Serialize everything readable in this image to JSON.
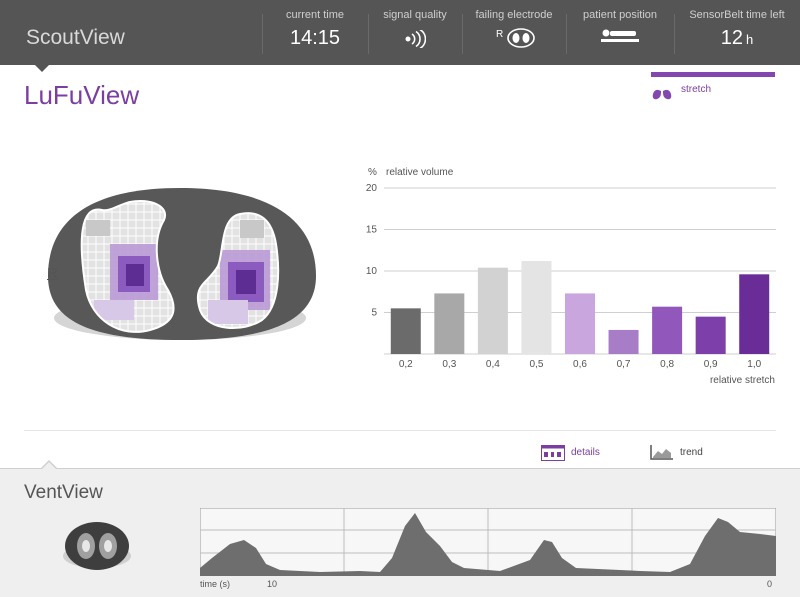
{
  "header": {
    "app_title": "ScoutView",
    "stats": [
      {
        "label": "current time",
        "value": "14:15",
        "unit": ""
      },
      {
        "label": "signal quality",
        "icon": "signal-icon"
      },
      {
        "label": "failing electrode",
        "value": "R",
        "icon": "electrode-icon"
      },
      {
        "label": "patient position",
        "icon": "patient-supine-icon"
      },
      {
        "label": "SensorBelt time left",
        "value": "12",
        "unit": "h"
      }
    ]
  },
  "lufu": {
    "title": "LuFuView",
    "side_marker": "R",
    "mode_tab": {
      "label": "stretch",
      "icon": "lungs-icon",
      "color": "#8447b0"
    }
  },
  "chart_data": {
    "type": "bar",
    "ylabel_unit": "%",
    "ylabel": "relative volume",
    "xlabel": "relative stretch",
    "ylim": [
      0,
      20
    ],
    "yticks": [
      5,
      10,
      15,
      20
    ],
    "categories": [
      "0,2",
      "0,3",
      "0,4",
      "0,5",
      "0,6",
      "0,7",
      "0,8",
      "0,9",
      "1,0"
    ],
    "values": [
      5.5,
      7.3,
      10.4,
      11.2,
      7.3,
      2.9,
      5.7,
      4.5,
      9.6
    ],
    "colors": [
      "#6b6b6b",
      "#a8a8a8",
      "#d2d2d2",
      "#e4e4e4",
      "#c9a6de",
      "#a77dc7",
      "#9157bb",
      "#7d3faa",
      "#6a2d98"
    ],
    "grid": true
  },
  "footer": {
    "details_label": "details",
    "trend_label": "trend",
    "accent": "#7a3fa0"
  },
  "vent": {
    "title": "VentView",
    "axis_label": "time (s)",
    "tick_left": "10",
    "tick_right": "0"
  }
}
